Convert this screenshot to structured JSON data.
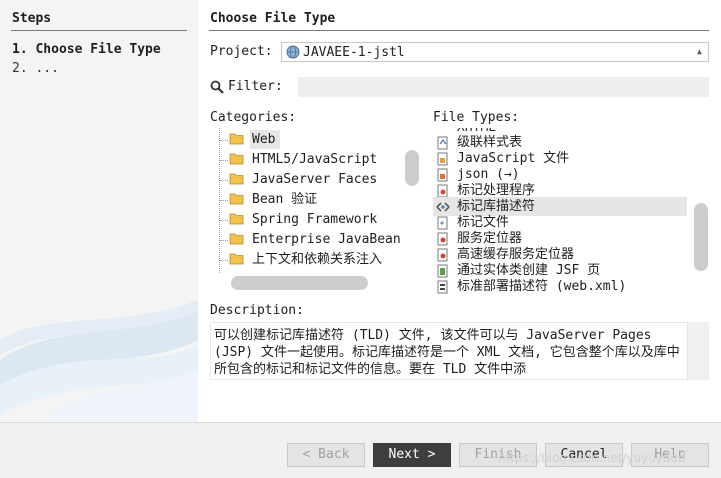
{
  "steps": {
    "title": "Steps",
    "items": [
      "1. Choose File Type",
      "2. ..."
    ]
  },
  "main": {
    "title": "Choose File Type",
    "project_label": "Project:",
    "project_value": "JAVAEE-1-jstl",
    "filter_label": "Filter:",
    "filter_value": "",
    "categories_label": "Categories:",
    "categories": [
      "Web",
      "HTML5/JavaScript",
      "JavaServer Faces",
      "Bean 验证",
      "Spring Framework",
      "Enterprise JavaBean",
      "上下文和依赖关系注入"
    ],
    "selected_category": "Web",
    "file_types_label": "File Types:",
    "file_types_partial_top": "XHTML",
    "file_types": [
      "级联样式表",
      "JavaScript 文件",
      "json (→)",
      "标记处理程序",
      "标记库描述符",
      "标记文件",
      "服务定位器",
      "高速缓存服务定位器",
      "通过实体类创建 JSF 页",
      "标准部署描述符 (web.xml)"
    ],
    "selected_file_type": "标记库描述符",
    "description_label": "Description:",
    "description_text": "可以创建标记库描述符 (TLD) 文件, 该文件可以与 JavaServer Pages (JSP) 文件一起使用。标记库描述符是一个 XML 文档, 它包含整个库以及库中所包含的标记和标记文件的信息。要在 TLD 文件中添"
  },
  "footer": {
    "back_label": "< Back",
    "next_label": "Next >",
    "finish_label": "Finish",
    "cancel_label": "Cancel",
    "help_label": "Help",
    "watermark": "https://blog.csdn.net/yuyuyddd"
  }
}
